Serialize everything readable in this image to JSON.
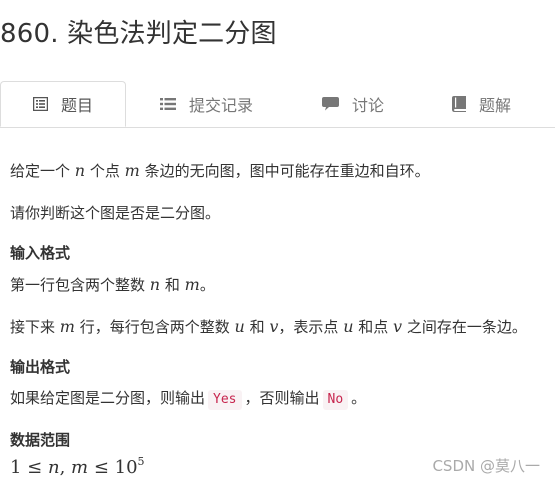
{
  "problem": {
    "title": "860. 染色法判定二分图"
  },
  "tabs": [
    {
      "label": "题目",
      "icon": "list-box-icon",
      "active": true
    },
    {
      "label": "提交记录",
      "icon": "list-icon",
      "active": false
    },
    {
      "label": "讨论",
      "icon": "comment-icon",
      "active": false
    },
    {
      "label": "题解",
      "icon": "book-icon",
      "active": false
    }
  ],
  "description": {
    "line1": {
      "p1": "给定一个 ",
      "v1": "n",
      "p2": " 个点 ",
      "v2": "m",
      "p3": " 条边的无向图，图中可能存在重边和自环。"
    },
    "line2": "请你判断这个图是否是二分图。"
  },
  "input_format": {
    "heading": "输入格式",
    "line1": {
      "p1": "第一行包含两个整数 ",
      "v1": "n",
      "p2": " 和 ",
      "v2": "m",
      "p3": "。"
    },
    "line2": {
      "p1": "接下来 ",
      "v1": "m",
      "p2": " 行，每行包含两个整数 ",
      "v2": "u",
      "p3": " 和 ",
      "v3": "v",
      "p4": "，表示点 ",
      "v4": "u",
      "p5": " 和点 ",
      "v5": "v",
      "p6": " 之间存在一条边。"
    }
  },
  "output_format": {
    "heading": "输出格式",
    "p1": "如果给定图是二分图，则输出",
    "yes": "Yes",
    "p2": "，否则输出",
    "no": "No",
    "p3": "。"
  },
  "data_range": {
    "heading": "数据范围",
    "lhs": "1 ≤ ",
    "n": "n",
    "comma": ", ",
    "m": "m",
    "le": " ≤ 10",
    "exp": "5"
  },
  "watermark": "CSDN @莫八一"
}
